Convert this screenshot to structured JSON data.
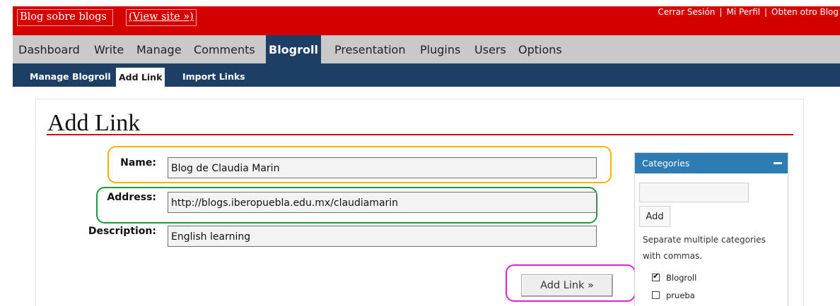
{
  "header": {
    "site_title": "Blog sobre blogs",
    "view_site": "(View site »)",
    "user_links": [
      "Cerrar Sesión",
      "Mi Perfil",
      "Obten otro Blog"
    ],
    "separator": "|"
  },
  "main_nav": {
    "items": [
      "Dashboard",
      "Write",
      "Manage",
      "Comments",
      "Blogroll",
      "Presentation",
      "Plugins",
      "Users",
      "Options"
    ],
    "active": "Blogroll"
  },
  "sub_nav": {
    "items": [
      "Manage Blogroll",
      "Add Link",
      "Import Links"
    ],
    "active": "Add Link"
  },
  "page": {
    "title": "Add Link"
  },
  "form": {
    "name_label": "Name:",
    "name_value": "Blog de Claudia Marin",
    "address_label": "Address:",
    "address_value": "http://blogs.iberopuebla.edu.mx/claudiamarin",
    "description_label": "Description:",
    "description_value": "English learning",
    "submit_label": "Add Link »"
  },
  "categories": {
    "title": "Categories",
    "input_value": "",
    "add_label": "Add",
    "help_text": "Separate multiple categories with commas.",
    "items": [
      {
        "label": "Blogroll",
        "checked": true
      },
      {
        "label": "prueba",
        "checked": false
      }
    ]
  },
  "colors": {
    "header_red": "#d40000",
    "nav_gray": "#c9c9c9",
    "nav_dark_blue": "#1d3f66",
    "categories_blue": "#2d7cb3",
    "title_rule_red": "#cc1111",
    "highlight_name": "#f2b400",
    "highlight_address": "#1a9a3a",
    "highlight_submit": "#e020e0"
  }
}
